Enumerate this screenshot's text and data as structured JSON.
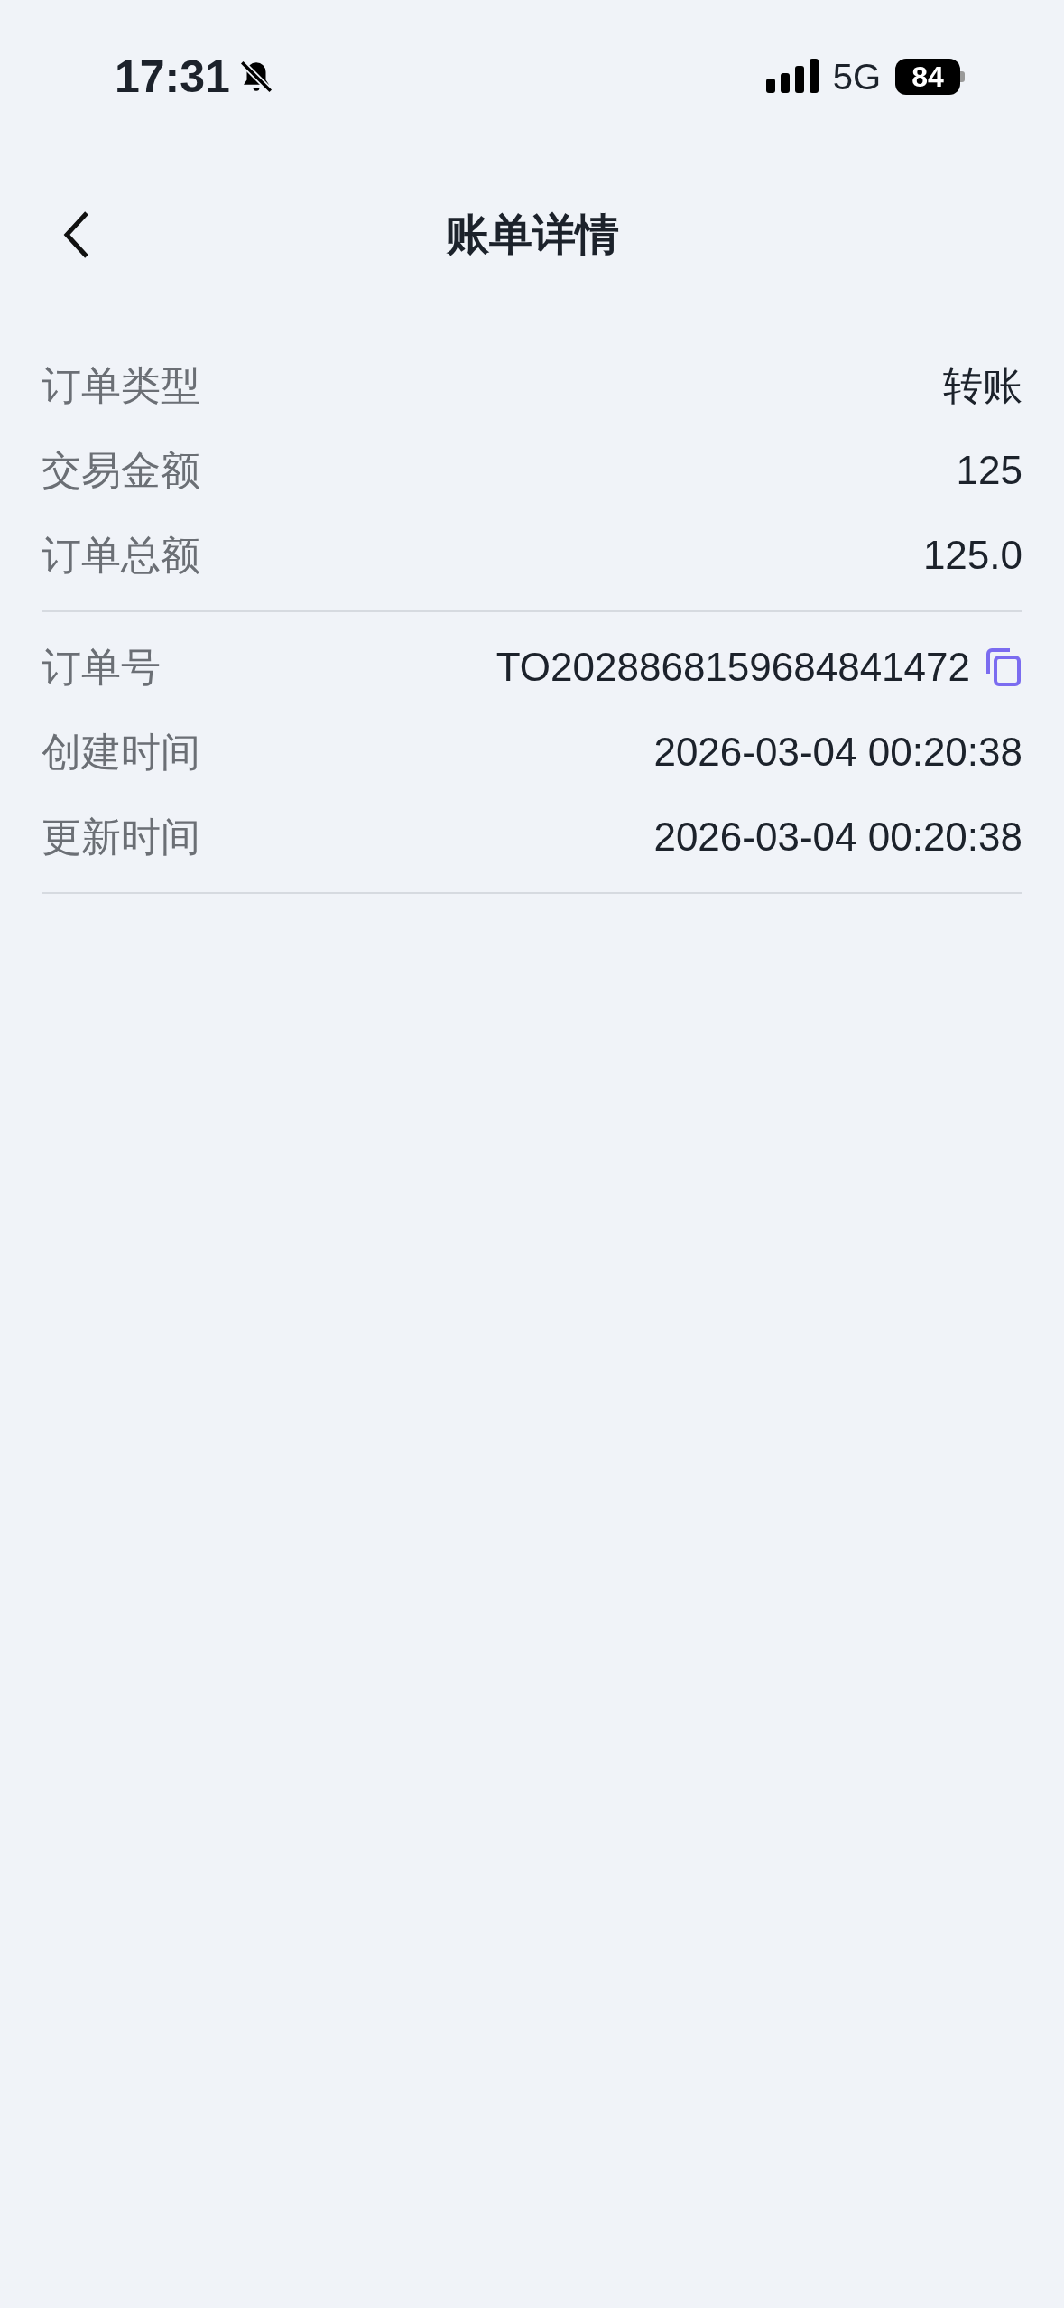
{
  "status_bar": {
    "time": "17:31",
    "network": "5G",
    "battery": "84"
  },
  "nav": {
    "title": "账单详情"
  },
  "sections": [
    {
      "rows": [
        {
          "label": "订单类型",
          "value": "转账",
          "copyable": false
        },
        {
          "label": "交易金额",
          "value": "125",
          "copyable": false
        },
        {
          "label": "订单总额",
          "value": "125.0",
          "copyable": false
        }
      ]
    },
    {
      "rows": [
        {
          "label": "订单号",
          "value": "TO2028868159684841472",
          "copyable": true
        },
        {
          "label": "创建时间",
          "value": "2026-03-04 00:20:38",
          "copyable": false
        },
        {
          "label": "更新时间",
          "value": "2026-03-04 00:20:38",
          "copyable": false
        }
      ]
    }
  ]
}
